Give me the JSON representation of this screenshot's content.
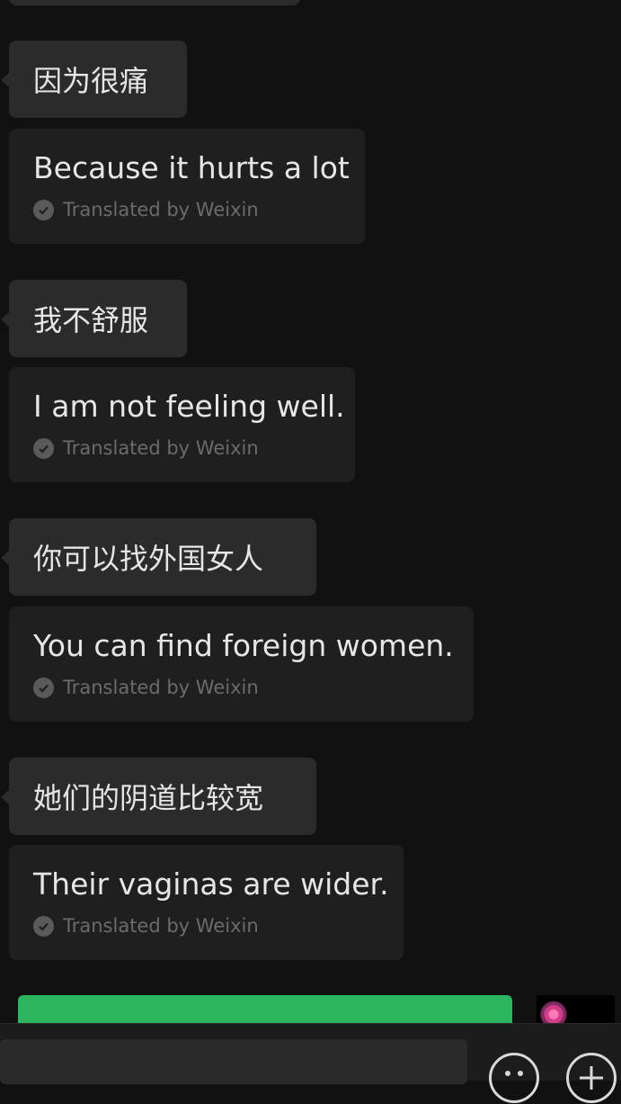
{
  "messages": [
    {
      "original": "因为很痛",
      "translation": "Because it hurts a lot",
      "translated_by": "Translated by Weixin"
    },
    {
      "original": "我不舒服",
      "translation": "I am not feeling well.",
      "translated_by": "Translated by Weixin"
    },
    {
      "original": "你可以找外国女人",
      "translation": "You can find foreign women.",
      "translated_by": "Translated by Weixin"
    },
    {
      "original": "她们的阴道比较宽",
      "translation": "Their vaginas are wider.",
      "translated_by": "Translated by Weixin"
    }
  ],
  "icons": {
    "check": "check-circle-icon",
    "emoji": "emoji-icon",
    "plus": "plus-circle-icon"
  },
  "colors": {
    "background": "#111111",
    "bubble": "#2b2b2b",
    "translation_bubble": "#1f1f1f",
    "accent_green": "#2bb55e"
  }
}
